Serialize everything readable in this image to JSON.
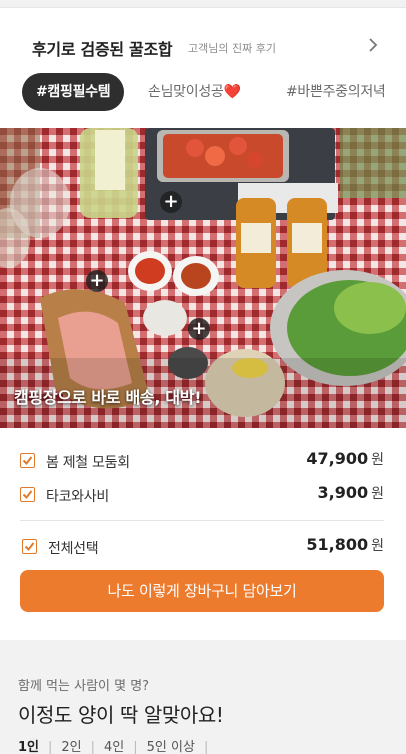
{
  "header": {
    "title": "후기로 검증된 꿀조합",
    "subtitle": "고객님의 진짜 후기",
    "chevron_icon": "chevron-right-icon"
  },
  "tabs": [
    {
      "label": "#캠핑필수템",
      "active": true
    },
    {
      "label": "손님맞이성공❤️",
      "active": false
    },
    {
      "label": "#바쁜주중의저녁",
      "active": false
    }
  ],
  "photo": {
    "caption": "캠핑장으로 바로 배송, 대박!",
    "tag_icon": "plus-icon"
  },
  "products": [
    {
      "name": "봄 제철 모둠회",
      "price": "47,900",
      "unit": "원",
      "checked": true
    },
    {
      "name": "타코와사비",
      "price": "3,900",
      "unit": "원",
      "checked": true
    }
  ],
  "total": {
    "label": "전체선택",
    "price": "51,800",
    "unit": "원",
    "checked": true
  },
  "cta": {
    "label": "나도 이렇게 장바구니 담아보기"
  },
  "portion": {
    "question": "함께 먹는 사람이 몇 명?",
    "headline": "이정도 양이 딱 알맞아요!",
    "options": [
      "1인",
      "2인",
      "4인",
      "5인 이상"
    ]
  },
  "colors": {
    "accent": "#ec7b2e",
    "tab_active": "#2e2e2e"
  }
}
